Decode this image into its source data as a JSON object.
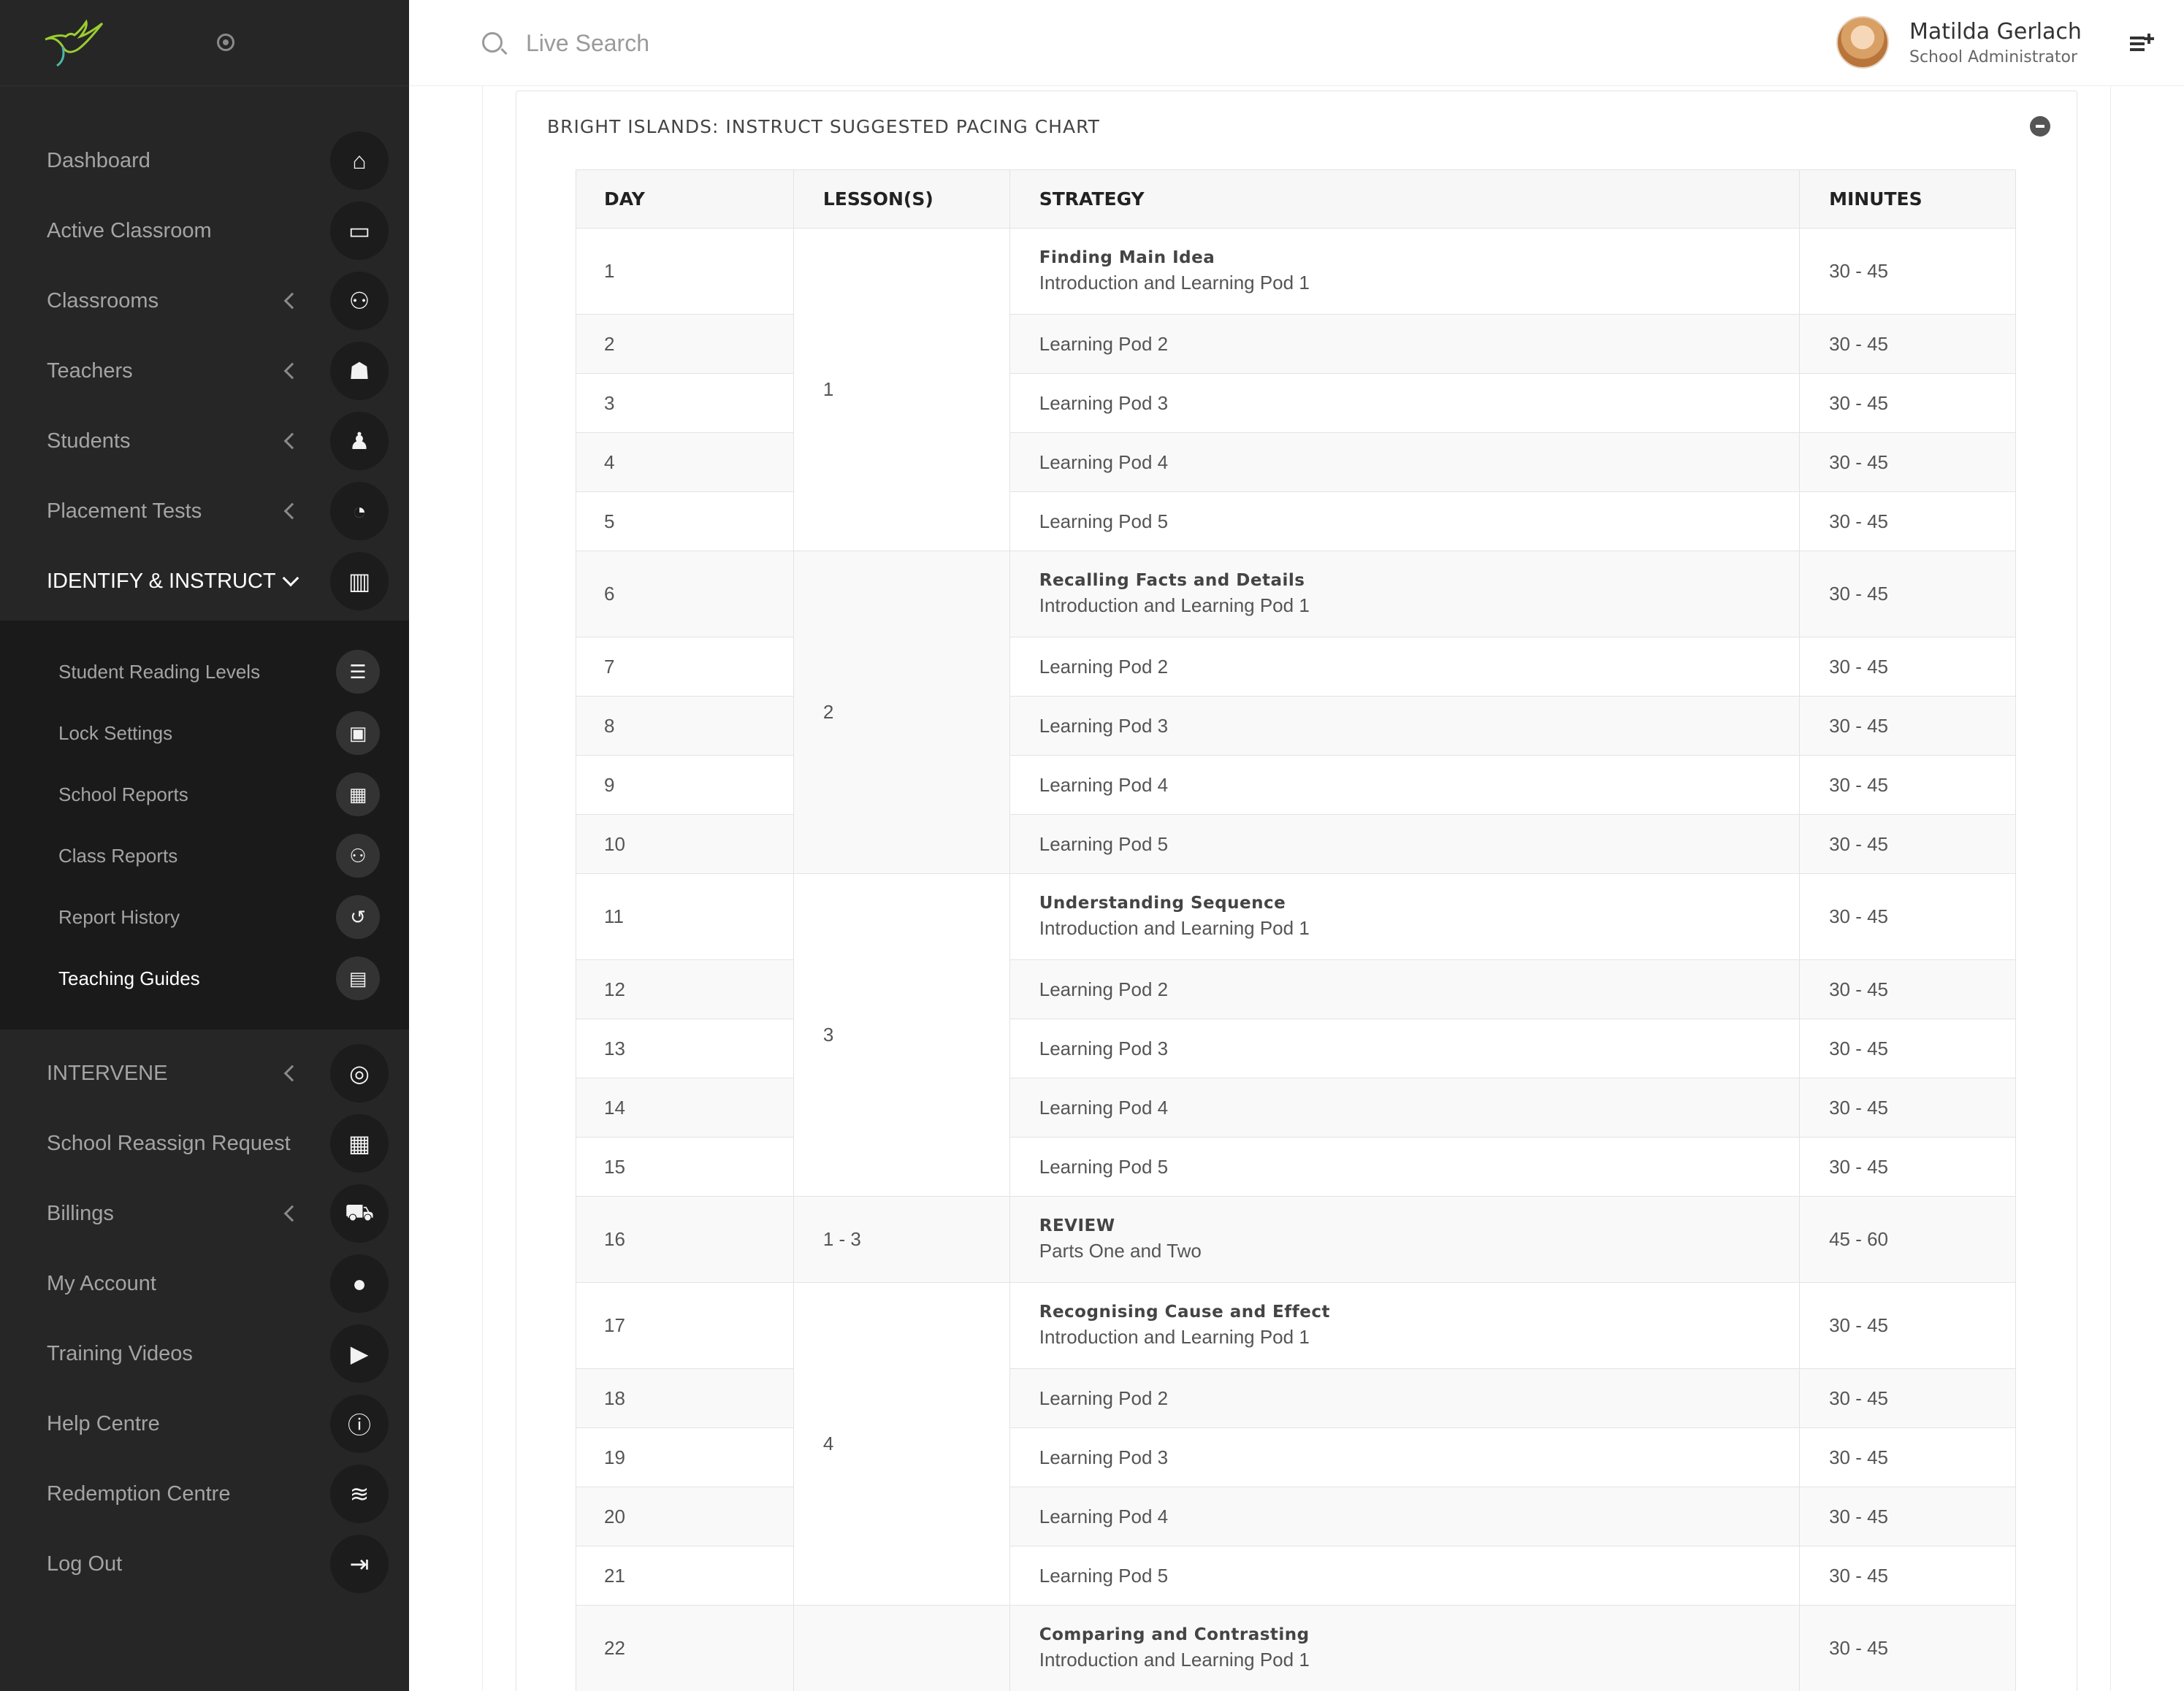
{
  "app": {
    "brand": "hummingbird-logo"
  },
  "topbar": {
    "search_placeholder": "Live Search",
    "user_name": "Matilda Gerlach",
    "user_role": "School Administrator"
  },
  "sidebar": {
    "items": [
      {
        "label": "Dashboard"
      },
      {
        "label": "Active Classroom"
      },
      {
        "label": "Classrooms"
      },
      {
        "label": "Teachers"
      },
      {
        "label": "Students"
      },
      {
        "label": "Placement Tests"
      },
      {
        "label": "IDENTIFY & INSTRUCT"
      },
      {
        "label": "INTERVENE"
      },
      {
        "label": "School Reassign Request"
      },
      {
        "label": "Billings"
      },
      {
        "label": "My Account"
      },
      {
        "label": "Training Videos"
      },
      {
        "label": "Help Centre"
      },
      {
        "label": "Redemption Centre"
      },
      {
        "label": "Log Out"
      }
    ],
    "submenu": [
      {
        "label": "Student Reading Levels"
      },
      {
        "label": "Lock Settings"
      },
      {
        "label": "School Reports"
      },
      {
        "label": "Class Reports"
      },
      {
        "label": "Report History"
      },
      {
        "label": "Teaching Guides"
      }
    ]
  },
  "panel": {
    "title": "BRIGHT ISLANDS: INSTRUCT SUGGESTED PACING CHART"
  },
  "table": {
    "headers": [
      "DAY",
      "LESSON(S)",
      "STRATEGY",
      "MINUTES"
    ],
    "rows": [
      {
        "day": "1",
        "lesson": "1",
        "title": "Finding Main Idea",
        "strategy": "Introduction and Learning Pod 1",
        "minutes": "30 - 45"
      },
      {
        "day": "2",
        "strategy": "Learning Pod 2",
        "minutes": "30 - 45"
      },
      {
        "day": "3",
        "strategy": "Learning Pod 3",
        "minutes": "30 - 45"
      },
      {
        "day": "4",
        "strategy": "Learning Pod 4",
        "minutes": "30 - 45"
      },
      {
        "day": "5",
        "strategy": "Learning Pod 5",
        "minutes": "30 - 45"
      },
      {
        "day": "6",
        "lesson": "2",
        "title": "Recalling Facts and Details",
        "strategy": "Introduction and Learning Pod 1",
        "minutes": "30 - 45"
      },
      {
        "day": "7",
        "strategy": "Learning Pod 2",
        "minutes": "30 - 45"
      },
      {
        "day": "8",
        "strategy": "Learning Pod 3",
        "minutes": "30 - 45"
      },
      {
        "day": "9",
        "strategy": "Learning Pod 4",
        "minutes": "30 - 45"
      },
      {
        "day": "10",
        "strategy": "Learning Pod 5",
        "minutes": "30 - 45"
      },
      {
        "day": "11",
        "lesson": "3",
        "title": "Understanding Sequence",
        "strategy": "Introduction and Learning Pod 1",
        "minutes": "30 - 45"
      },
      {
        "day": "12",
        "strategy": "Learning Pod 2",
        "minutes": "30 - 45"
      },
      {
        "day": "13",
        "strategy": "Learning Pod 3",
        "minutes": "30 - 45"
      },
      {
        "day": "14",
        "strategy": "Learning Pod 4",
        "minutes": "30 - 45"
      },
      {
        "day": "15",
        "strategy": "Learning Pod 5",
        "minutes": "30 - 45"
      },
      {
        "day": "16",
        "lesson": "1 - 3",
        "title": "REVIEW",
        "strategy": "Parts One and Two",
        "minutes": "45 - 60"
      },
      {
        "day": "17",
        "lesson": "4",
        "title": "Recognising Cause and Effect",
        "strategy": "Introduction and Learning Pod 1",
        "minutes": "30 - 45"
      },
      {
        "day": "18",
        "strategy": "Learning Pod 2",
        "minutes": "30 - 45"
      },
      {
        "day": "19",
        "strategy": "Learning Pod 3",
        "minutes": "30 - 45"
      },
      {
        "day": "20",
        "strategy": "Learning Pod 4",
        "minutes": "30 - 45"
      },
      {
        "day": "21",
        "strategy": "Learning Pod 5",
        "minutes": "30 - 45"
      },
      {
        "day": "22",
        "lesson": "",
        "title": "Comparing and Contrasting",
        "strategy": "Introduction and Learning Pod 1",
        "minutes": "30 - 45"
      }
    ]
  },
  "colors": {
    "sidebar": "#262626",
    "submenu": "#1a1a1a",
    "accent": "#9acd32"
  }
}
